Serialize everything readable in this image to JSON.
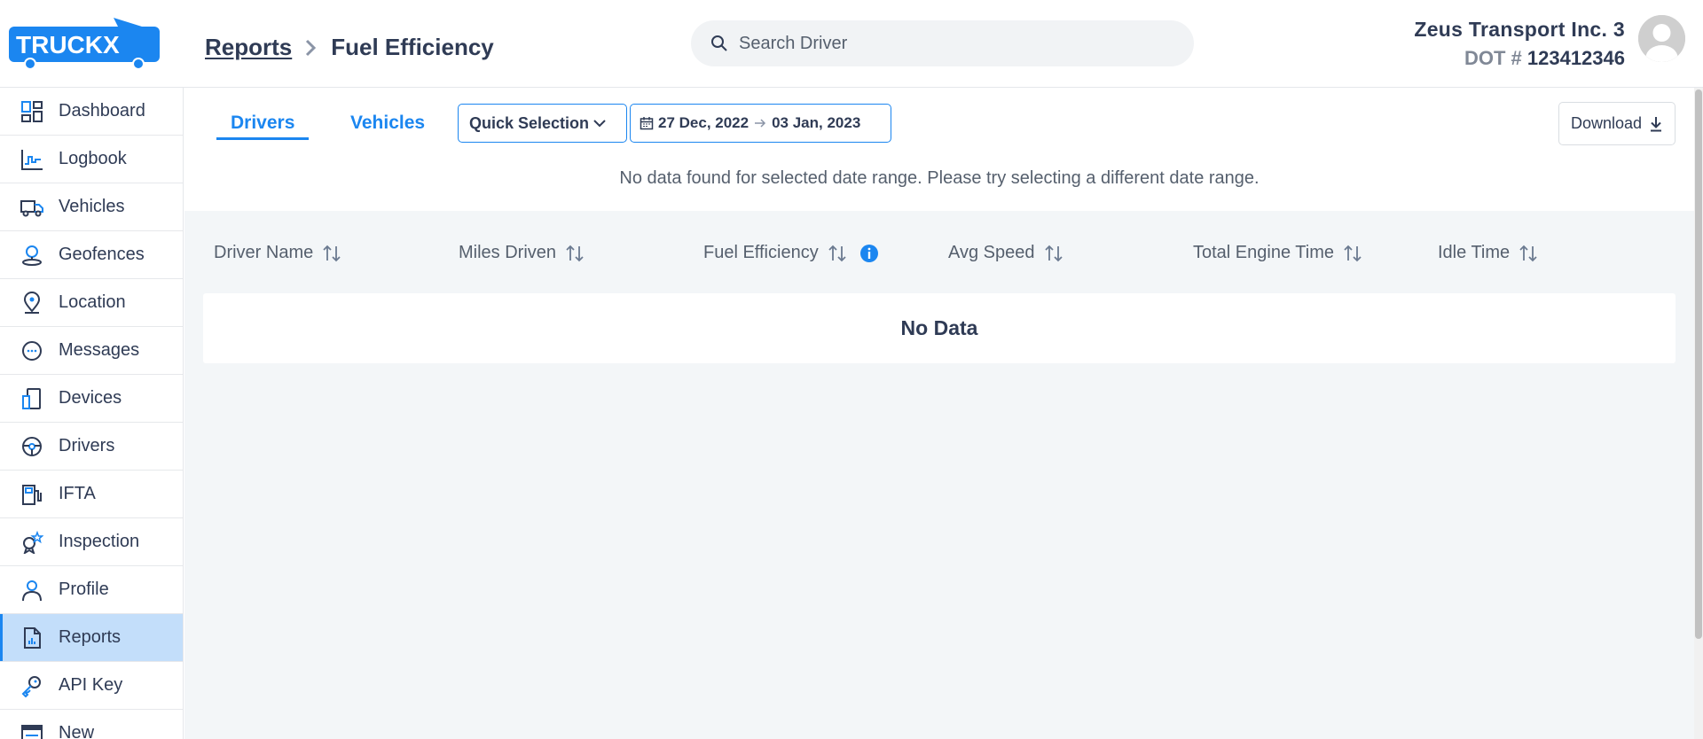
{
  "header": {
    "logo_text": "TRUCKX",
    "breadcrumb": {
      "parent": "Reports",
      "current": "Fuel Efficiency"
    },
    "search": {
      "placeholder": "Search Driver",
      "value": ""
    },
    "company_name": "Zeus Transport Inc. 3",
    "dot_label": "DOT #",
    "dot_number": "123412346"
  },
  "sidebar": {
    "items": [
      {
        "label": "Dashboard",
        "icon": "dashboard-icon"
      },
      {
        "label": "Logbook",
        "icon": "logbook-icon"
      },
      {
        "label": "Vehicles",
        "icon": "truck-icon"
      },
      {
        "label": "Geofences",
        "icon": "geofence-icon"
      },
      {
        "label": "Location",
        "icon": "location-pin-icon"
      },
      {
        "label": "Messages",
        "icon": "message-icon"
      },
      {
        "label": "Devices",
        "icon": "device-icon"
      },
      {
        "label": "Drivers",
        "icon": "steering-wheel-icon"
      },
      {
        "label": "IFTA",
        "icon": "fuel-pump-icon"
      },
      {
        "label": "Inspection",
        "icon": "inspection-icon"
      },
      {
        "label": "Profile",
        "icon": "user-icon"
      },
      {
        "label": "Reports",
        "icon": "report-icon",
        "active": true
      },
      {
        "label": "API Key",
        "icon": "key-icon"
      },
      {
        "label": "New",
        "icon": "new-icon"
      }
    ]
  },
  "toolbar": {
    "tabs": [
      {
        "label": "Drivers",
        "active": true
      },
      {
        "label": "Vehicles",
        "active": false
      }
    ],
    "quick_selection": "Quick Selection",
    "date_start": "27 Dec, 2022",
    "date_end": "03 Jan, 2023",
    "download": "Download",
    "no_data_message": "No data found for selected date range. Please try selecting a different date range."
  },
  "table": {
    "columns": [
      "Driver Name",
      "Miles Driven",
      "Fuel Efficiency",
      "Avg Speed",
      "Total Engine Time",
      "Idle Time"
    ],
    "empty_text": "No Data"
  },
  "colors": {
    "accent": "#1b86f0",
    "active_nav_bg": "#c3defa",
    "text_dark": "#2f3b55",
    "content_bg": "#f3f6f8"
  }
}
